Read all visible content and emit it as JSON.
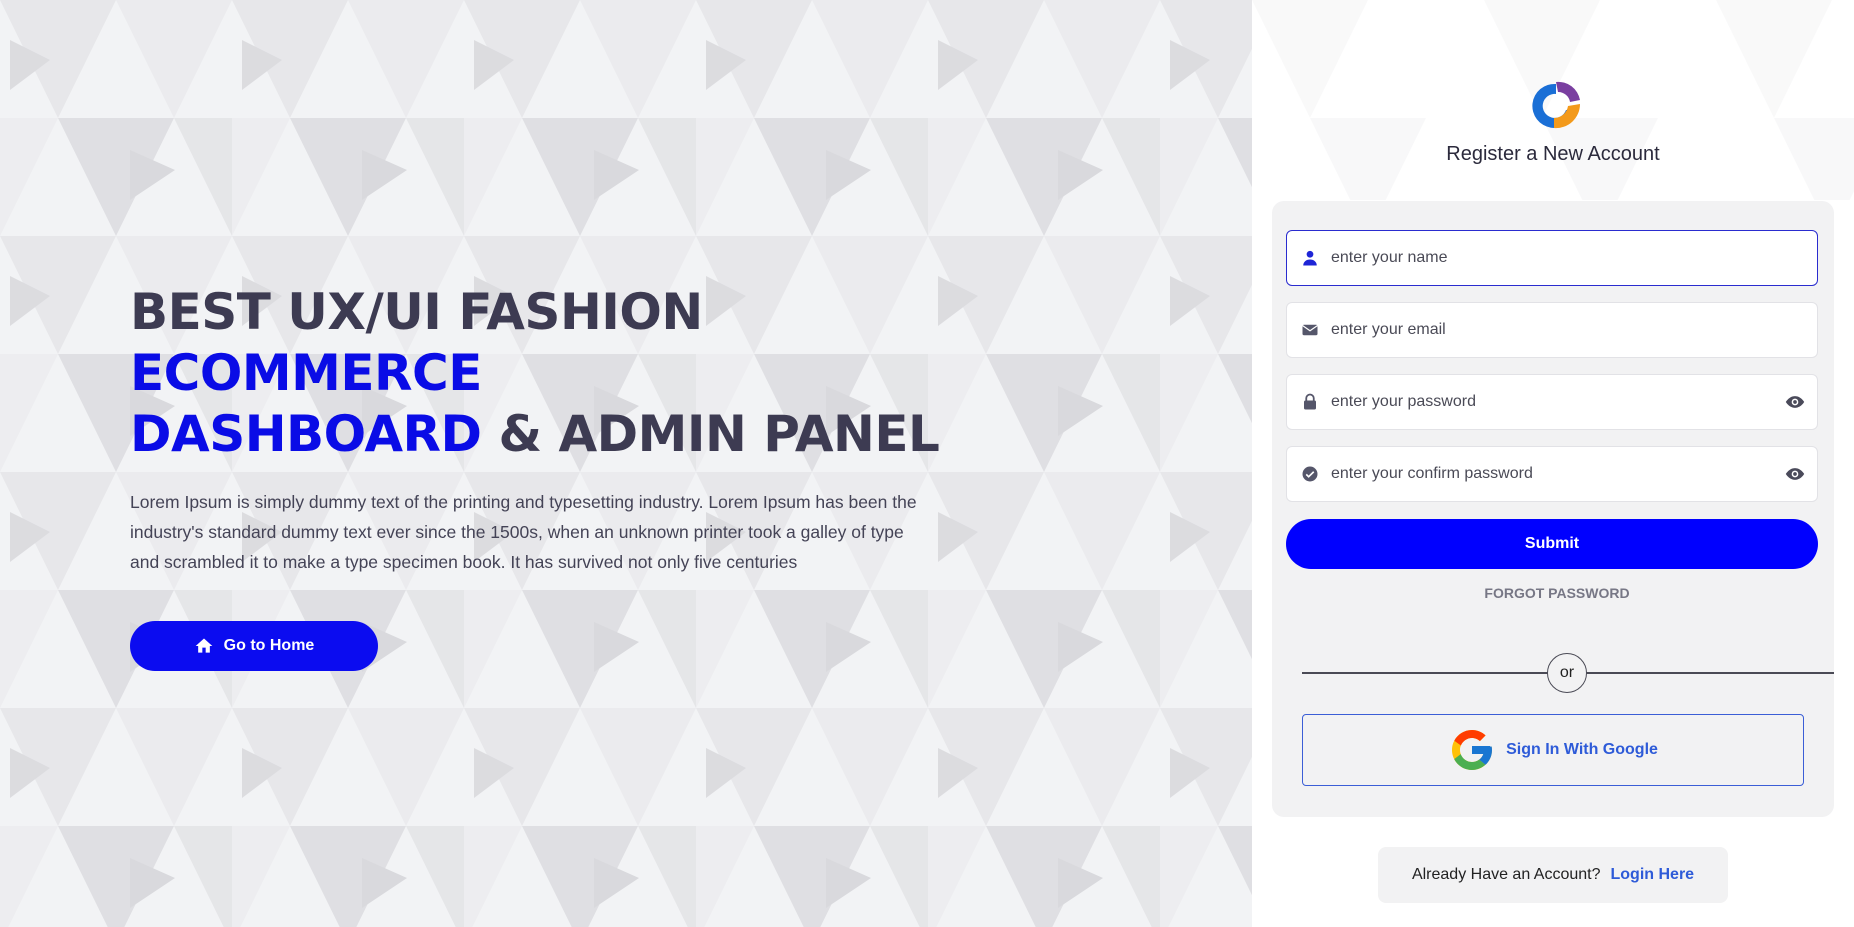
{
  "hero": {
    "title_part1": "BEST UX/UI FASHION ",
    "title_accent1": "ECOMMERCE",
    "title_accent2": "DASHBOARD",
    "title_part2": " & ADMIN PANEL",
    "description": "Lorem Ipsum is simply dummy text of the printing and typesetting industry. Lorem Ipsum has been the industry's standard dummy text ever since the 1500s, when an unknown printer took a galley of type and scrambled it to make a type specimen book. It has survived not only five centuries",
    "home_button_label": "Go to Home",
    "home_icon": "home-icon"
  },
  "register": {
    "title": "Register a New Account",
    "fields": {
      "name_placeholder": "enter your name",
      "email_placeholder": "enter your email",
      "password_placeholder": "enter your password",
      "confirm_placeholder": "enter your confirm password"
    },
    "submit_label": "Submit",
    "forgot_label": "FORGOT PASSWORD",
    "divider_label": "or",
    "google_label": "Sign In With Google",
    "login_prompt": "Already Have an Account?",
    "login_link": "Login Here"
  },
  "colors": {
    "accent": "#0000ff",
    "title_dark": "#3d3b52",
    "link": "#2e5bd8"
  }
}
